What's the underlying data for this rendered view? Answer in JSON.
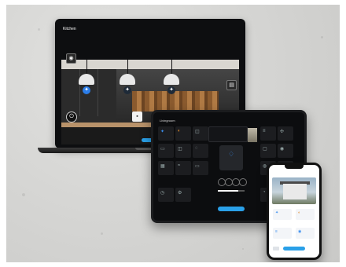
{
  "laptop": {
    "title": "Kitchen",
    "subtitle": "",
    "icons": {
      "camera": "camera-icon",
      "lamp_left": "bulb-icon",
      "lamp_middle": "bulb-icon",
      "lamp_right": "bulb-icon",
      "power": "power-icon",
      "socket": "socket-icon",
      "switch": "switch-icon"
    },
    "status_pill": "",
    "accent_color": "#2aa0e8"
  },
  "tablet": {
    "title": "Livingroom",
    "modal_title": "",
    "modal_subtitle": "",
    "slider_fraction": 0.75,
    "accent_color": "#2aa0e8"
  },
  "phone": {
    "title": "",
    "cards": [
      "",
      "",
      "",
      ""
    ],
    "accent_color": "#2aa0e8"
  },
  "colors": {
    "background": "#d6d6d4",
    "device_dark": "#0d0e10",
    "tile_blue": "#3b8ff0",
    "tile_orange": "#e08a2a"
  }
}
